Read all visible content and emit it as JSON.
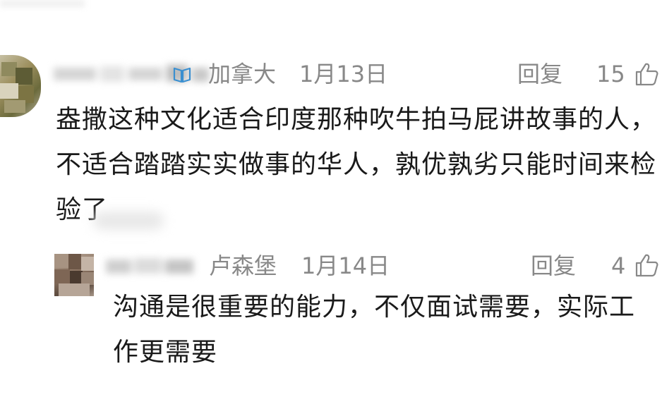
{
  "comments": [
    {
      "location": "加拿大",
      "date": "1月13日",
      "reply_label": "回复",
      "likes": "15",
      "text": "盎撒这种文化适合印度那种吹牛拍马屁讲故事的人，不适合踏踏实实做事的华人，孰优孰劣只能时间来检验了",
      "badge_icon": "book-badge-icon"
    },
    {
      "location": "卢森堡",
      "date": "1月14日",
      "reply_label": "回复",
      "likes": "4",
      "text": "沟通是很重要的能力，不仅面试需要，实际工作更需要"
    }
  ],
  "colors": {
    "meta_text": "#888888",
    "body_text": "#1a1a1a",
    "badge_accent": "#3a8fd0",
    "background": "#ffffff"
  }
}
